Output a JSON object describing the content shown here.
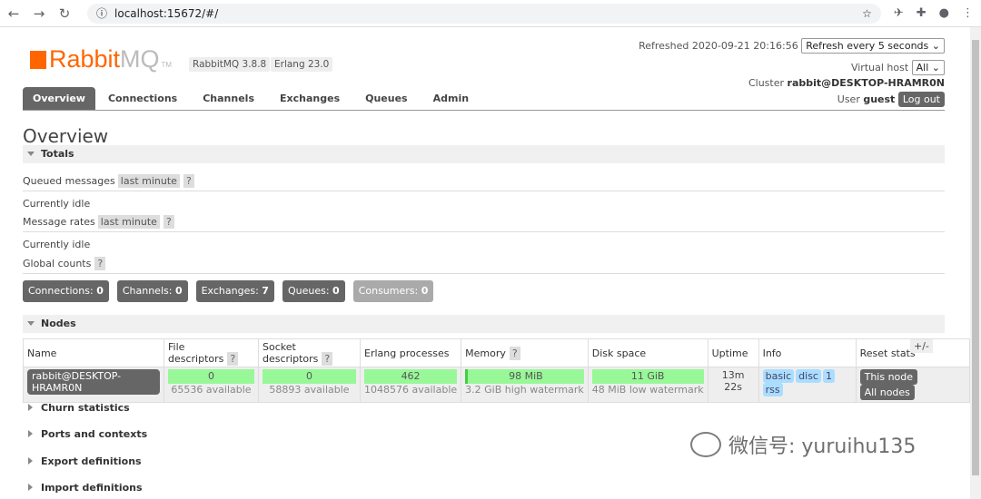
{
  "browser": {
    "url": "localhost:15672/#/"
  },
  "header": {
    "logo": "RabbitMQ",
    "version": "RabbitMQ 3.8.8",
    "erlang": "Erlang 23.0",
    "refreshed_label": "Refreshed",
    "refreshed": "2020-09-21 20:16:56",
    "refresh_option": "Refresh every 5 seconds",
    "vhost_label": "Virtual host",
    "vhost": "All",
    "cluster_label": "Cluster",
    "cluster": "rabbit@DESKTOP-HRAMR0N",
    "user_label": "User",
    "user": "guest",
    "logout": "Log out"
  },
  "tabs": [
    "Overview",
    "Connections",
    "Channels",
    "Exchanges",
    "Queues",
    "Admin"
  ],
  "title": "Overview",
  "totals": {
    "heading": "Totals",
    "queued_label": "Queued messages",
    "queued_range": "last minute",
    "idle1": "Currently idle",
    "rates_label": "Message rates",
    "rates_range": "last minute",
    "idle2": "Currently idle",
    "global_label": "Global counts",
    "help": "?"
  },
  "counts": [
    {
      "label": "Connections:",
      "value": "0"
    },
    {
      "label": "Channels:",
      "value": "0"
    },
    {
      "label": "Exchanges:",
      "value": "7"
    },
    {
      "label": "Queues:",
      "value": "0"
    },
    {
      "label": "Consumers:",
      "value": "0"
    }
  ],
  "nodes": {
    "heading": "Nodes",
    "columns": [
      "Name",
      "File descriptors",
      "Socket descriptors",
      "Erlang processes",
      "Memory",
      "Disk space",
      "Uptime",
      "Info",
      "Reset stats"
    ],
    "toggle": "+/-",
    "row": {
      "name": "rabbit@DESKTOP-HRAMR0N",
      "fd": "0",
      "fd_avail": "65536 available",
      "sd": "0",
      "sd_avail": "58893 available",
      "ep": "462",
      "ep_avail": "1048576 available",
      "mem": "98 MiB",
      "mem_sub": "3.2 GiB high watermark",
      "disk": "11 GiB",
      "disk_sub": "48 MiB low watermark",
      "uptime": "13m 22s",
      "info": [
        "basic",
        "disc",
        "1",
        "rss"
      ],
      "reset_this": "This node",
      "reset_all": "All nodes"
    }
  },
  "sections": [
    "Churn statistics",
    "Ports and contexts",
    "Export definitions",
    "Import definitions"
  ],
  "watermark": "微信号: yuruihu135"
}
